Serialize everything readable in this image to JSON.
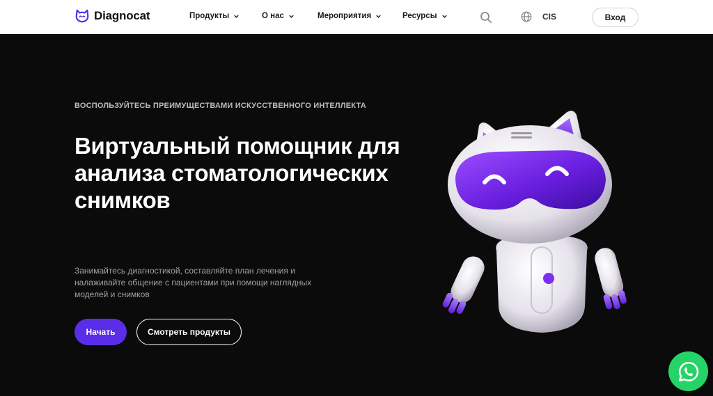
{
  "header": {
    "brand": "Diagnocat",
    "nav": [
      {
        "label": "Продукты"
      },
      {
        "label": "О нас"
      },
      {
        "label": "Мероприятия"
      },
      {
        "label": "Ресурсы"
      }
    ],
    "region": "CIS",
    "login_label": "Вход",
    "icons": [
      "logo-cat-icon",
      "chevron-down-icon",
      "search-icon",
      "globe-icon"
    ]
  },
  "hero": {
    "eyebrow": "ВОСПОЛЬЗУЙТЕСЬ ПРЕИМУЩЕСТВАМИ ИСКУССТВЕННОГО ИНТЕЛЛЕКТА",
    "headline": "Виртуальный помощник для анализа стоматологических снимков",
    "subtext": "Занимайтесь диагностикой, составляйте план лечения и налаживайте общение с пациентами при помощи наглядных моделей и снимков",
    "primary_cta": "Начать",
    "secondary_cta": "Смотреть продукты",
    "illustration": "robot-cat-mascot"
  },
  "floating": {
    "chat_icon": "whatsapp-icon"
  },
  "colors": {
    "accent": "#5a2ee8",
    "background": "#0b0b0b",
    "header_bg": "#ffffff",
    "whatsapp": "#25d366",
    "robot_visor": "#7b2ff0"
  }
}
